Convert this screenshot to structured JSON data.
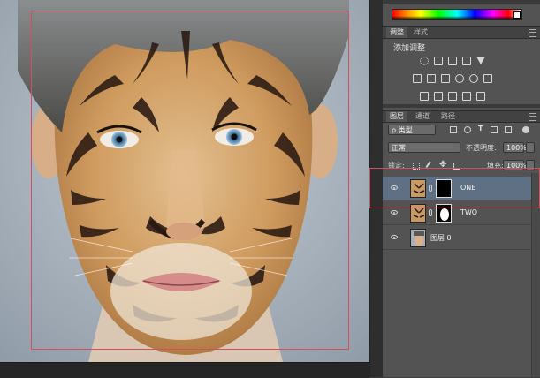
{
  "colors": {
    "canvas_bg": "#aab4bd",
    "selection": "#d0525c",
    "panel_bg": "#535353",
    "selected_layer": "#5f7085"
  },
  "panels": {
    "adjust_tabs": [
      {
        "label": "调整",
        "active": true
      },
      {
        "label": "样式",
        "active": false
      }
    ],
    "adjust_title": "添加调整",
    "adjust_icons": [
      "brightness-icon",
      "levels-icon",
      "curves-icon",
      "exposure-icon",
      "vibrance-icon",
      "hue-saturation-icon",
      "color-balance-icon",
      "black-white-icon",
      "photo-filter-icon",
      "channel-mixer-icon",
      "color-lookup-icon",
      "invert-icon",
      "posterize-icon",
      "threshold-icon",
      "selective-color-icon",
      "gradient-map-icon"
    ],
    "layer_tabs": [
      {
        "label": "图层",
        "active": true
      },
      {
        "label": "通道",
        "active": false
      },
      {
        "label": "路径",
        "active": false
      }
    ],
    "filter_kind": "ρ 类型",
    "blend_mode": "正常",
    "opacity_label": "不透明度:",
    "opacity_value": "100%",
    "lock_label": "锁定:",
    "fill_label": "填充:",
    "fill_value": "100%",
    "layers": [
      {
        "name": "ONE",
        "selected": true,
        "has_mask": true,
        "mask": "black"
      },
      {
        "name": "TWO",
        "selected": false,
        "has_mask": true,
        "mask": "face"
      },
      {
        "name": "图层 0",
        "selected": false,
        "has_mask": false
      }
    ]
  }
}
